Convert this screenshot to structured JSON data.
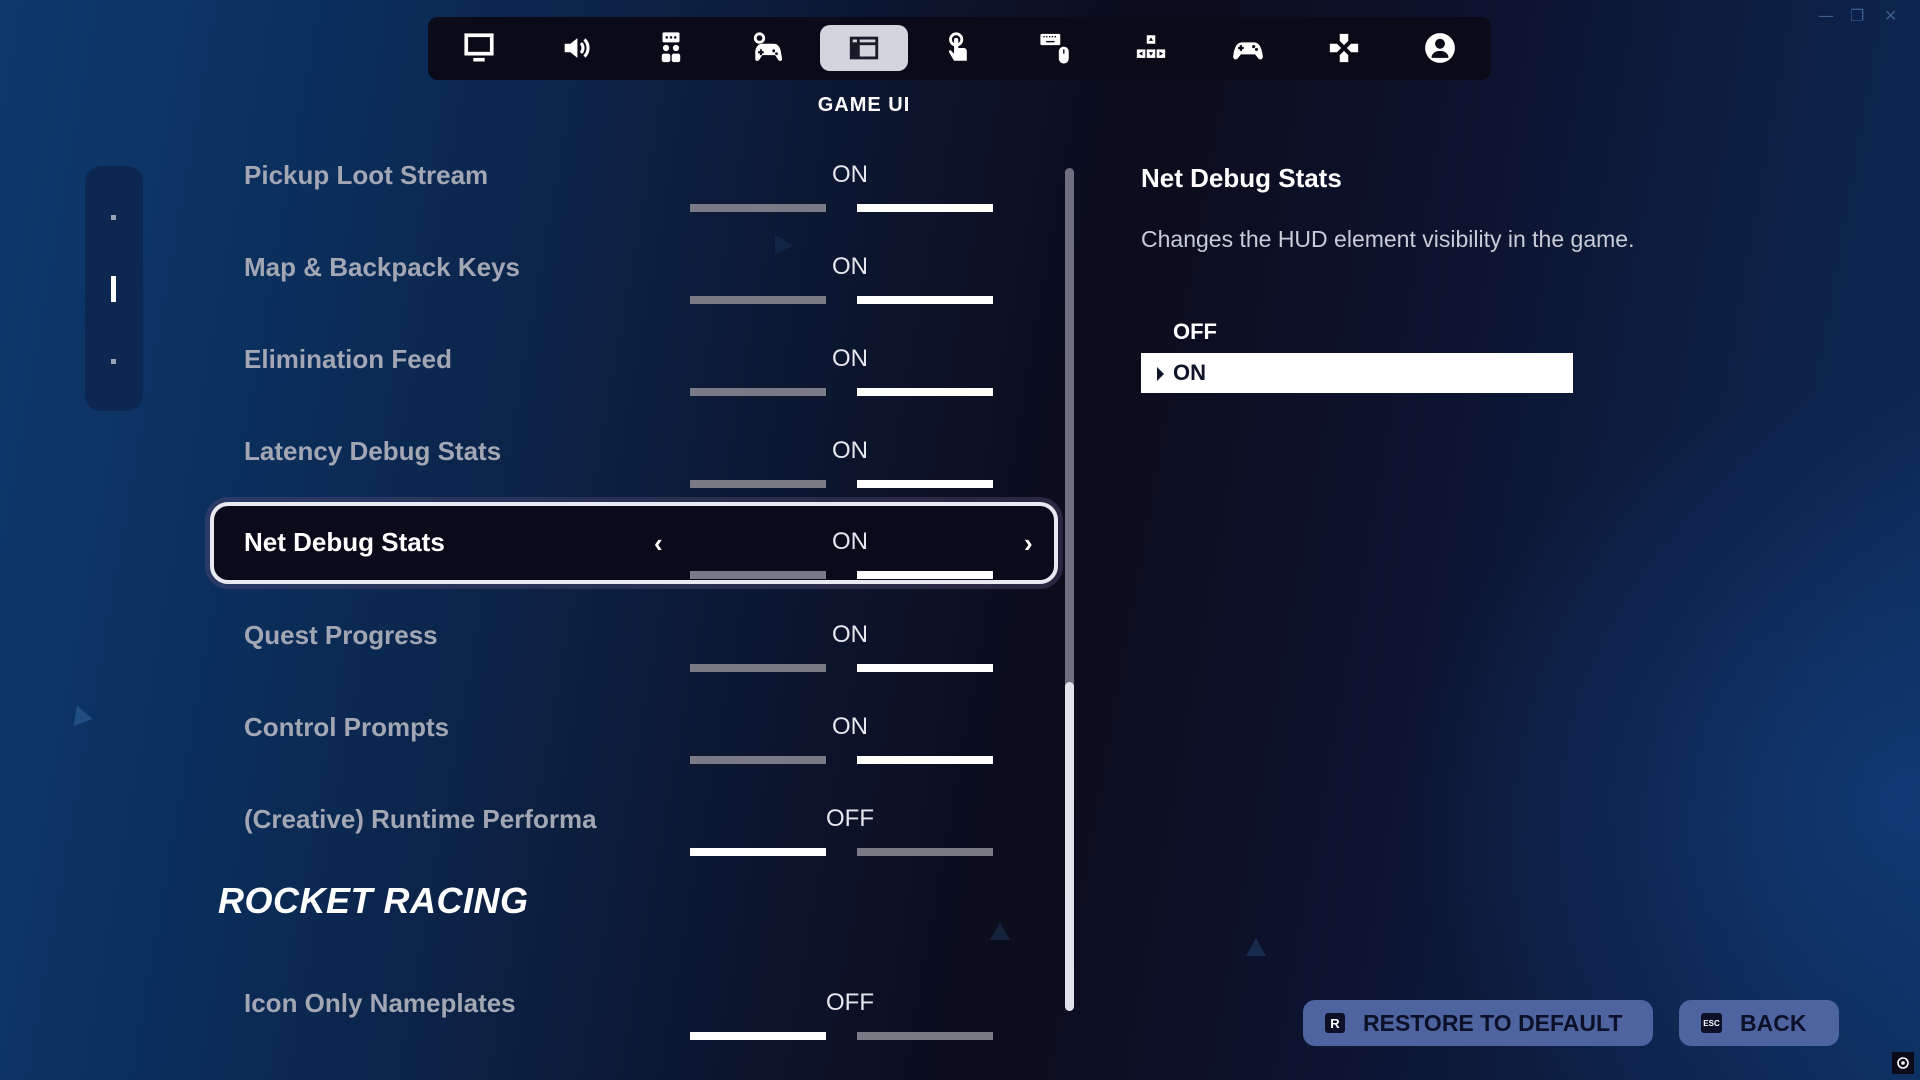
{
  "window_controls": {
    "minimize": "—",
    "restore": "❐",
    "close": "✕"
  },
  "tabs": [
    {
      "icon": "monitor-icon",
      "name": "video"
    },
    {
      "icon": "speaker-icon",
      "name": "audio"
    },
    {
      "icon": "social-icon",
      "name": "accessibility"
    },
    {
      "icon": "controller-gear-icon",
      "name": "game"
    },
    {
      "icon": "game-ui-icon",
      "name": "game-ui",
      "active": true
    },
    {
      "icon": "touch-icon",
      "name": "touch"
    },
    {
      "icon": "keyboard-mouse-icon",
      "name": "keyboard-mouse"
    },
    {
      "icon": "arrow-keys-icon",
      "name": "keyboard-controls"
    },
    {
      "icon": "controller-icon",
      "name": "controller"
    },
    {
      "icon": "dpad-icon",
      "name": "controller-bindings"
    },
    {
      "icon": "account-icon",
      "name": "account"
    }
  ],
  "active_tab_title": "GAME UI",
  "section_nav": {
    "count": 3,
    "active_index": 1
  },
  "settings": [
    {
      "label": "Pickup Loot Stream",
      "value": "ON",
      "on": true
    },
    {
      "label": "Map & Backpack Keys",
      "value": "ON",
      "on": true
    },
    {
      "label": "Elimination Feed",
      "value": "ON",
      "on": true
    },
    {
      "label": "Latency Debug Stats",
      "value": "ON",
      "on": true
    },
    {
      "label": "Net Debug Stats",
      "value": "ON",
      "on": true,
      "selected": true
    },
    {
      "label": "Quest Progress",
      "value": "ON",
      "on": true
    },
    {
      "label": "Control Prompts",
      "value": "ON",
      "on": true
    },
    {
      "label": "(Creative) Runtime Performa",
      "value": "OFF",
      "on": false
    }
  ],
  "section_header": "ROCKET RACING",
  "section_settings": [
    {
      "label": "Icon Only Nameplates",
      "value": "OFF",
      "on": false
    }
  ],
  "selector_arrows": {
    "left": "‹",
    "right": "›"
  },
  "scroll": {
    "position_fraction": 1.0,
    "visible_fraction": 0.39
  },
  "detail": {
    "title": "Net Debug Stats",
    "description": "Changes the HUD element visibility in the game.",
    "options": [
      {
        "label": "OFF",
        "selected": false
      },
      {
        "label": "ON",
        "selected": true
      }
    ]
  },
  "footer": {
    "restore": {
      "key": "R",
      "label": "RESTORE TO DEFAULT"
    },
    "back": {
      "key": "ESC",
      "label": "BACK"
    }
  },
  "colors": {
    "accent_button": "#4d64a0",
    "active_tab": "#d4d4dc",
    "toggle_lit": "#ffffff",
    "toggle_dim": "#7a7a86"
  }
}
